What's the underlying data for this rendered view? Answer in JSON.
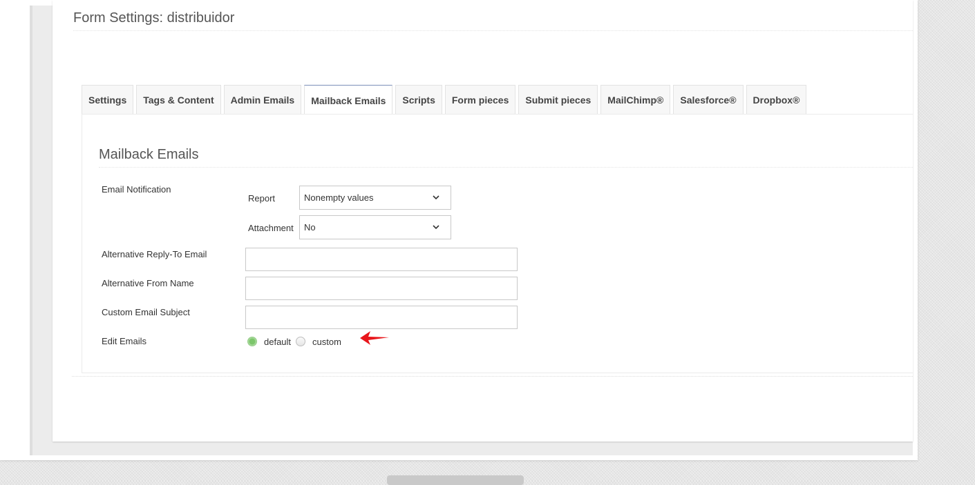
{
  "page": {
    "title": "Form Settings: distribuidor"
  },
  "tabs": [
    {
      "label": "Settings"
    },
    {
      "label": "Tags & Content"
    },
    {
      "label": "Admin Emails"
    },
    {
      "label": "Mailback Emails",
      "active": true
    },
    {
      "label": "Scripts"
    },
    {
      "label": "Form pieces"
    },
    {
      "label": "Submit pieces"
    },
    {
      "label": "MailChimp®"
    },
    {
      "label": "Salesforce®"
    },
    {
      "label": "Dropbox®"
    }
  ],
  "section": {
    "title": "Mailback Emails"
  },
  "email_notification": {
    "label": "Email Notification",
    "report": {
      "label": "Report",
      "value": "Nonempty values"
    },
    "attachment": {
      "label": "Attachment",
      "value": "No"
    }
  },
  "fields": {
    "reply_to": {
      "label": "Alternative Reply-To Email",
      "value": ""
    },
    "from_name": {
      "label": "Alternative From Name",
      "value": ""
    },
    "subject": {
      "label": "Custom Email Subject",
      "value": ""
    }
  },
  "edit_emails": {
    "label": "Edit Emails",
    "options": [
      {
        "label": "default",
        "checked": true
      },
      {
        "label": "custom",
        "checked": false
      }
    ]
  },
  "colors": {
    "annotation_arrow": "#e8161b",
    "radio_checked": "#7cc66b",
    "active_tab_border": "#7b8fb8"
  },
  "icons": {
    "select_chevron": "chevron-down-icon",
    "annotation": "red-arrow-icon"
  }
}
